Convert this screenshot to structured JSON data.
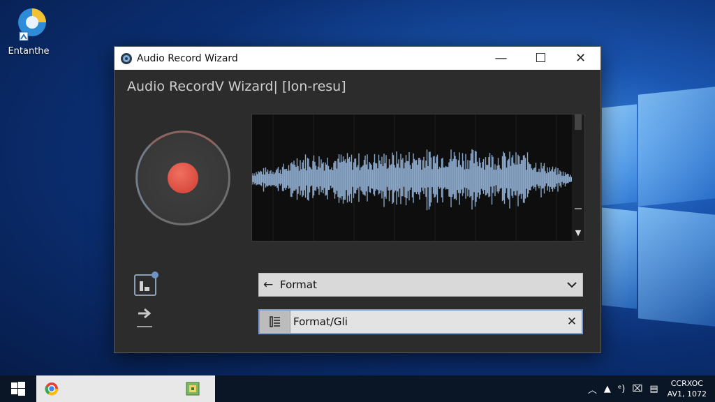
{
  "desktop": {
    "icon_label": "Entanthe"
  },
  "window": {
    "title": "Audio Record Wizard",
    "heading": "Audio RecordV Wizard|  [lon-resu]",
    "controls": {
      "minimize": "—",
      "maximize": "☐",
      "close": "✕"
    }
  },
  "format_select": {
    "label": "Format"
  },
  "format_input": {
    "value": "Format/Gli",
    "clear_label": "✕"
  },
  "waveform": {
    "scroll_down_label": "▼"
  },
  "tray": {
    "chevron": "︿",
    "clock_line1": "CCRXOC",
    "clock_line2": "AV1, 1072"
  },
  "colors": {
    "record_accent": "#d94c40",
    "waveform_color": "#8aa6c8",
    "window_bg": "#2c2c2c"
  }
}
